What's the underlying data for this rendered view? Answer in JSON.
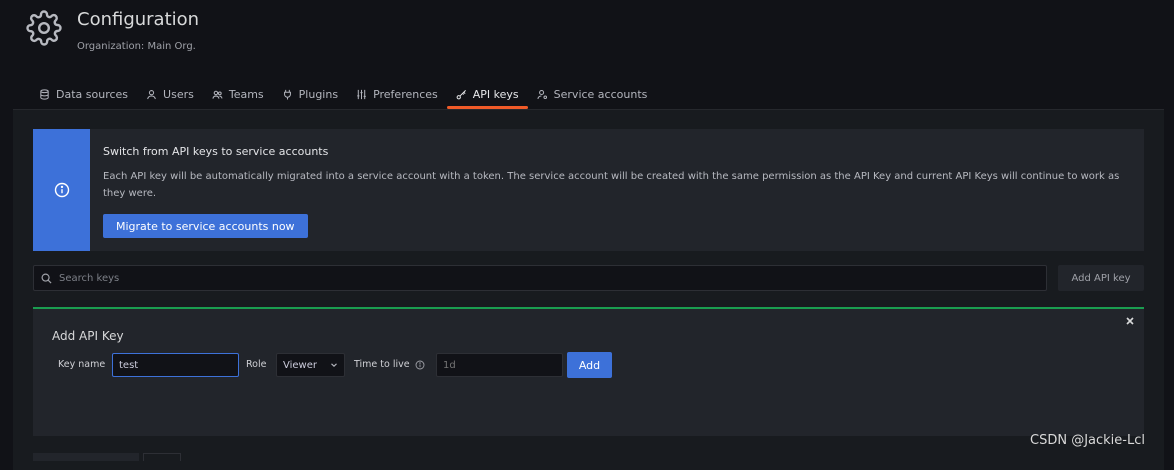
{
  "header": {
    "title": "Configuration",
    "subtitle": "Organization: Main Org.",
    "icon": "gear-icon"
  },
  "tabs": [
    {
      "label": "Data sources",
      "icon": "database-icon",
      "active": false
    },
    {
      "label": "Users",
      "icon": "user-icon",
      "active": false
    },
    {
      "label": "Teams",
      "icon": "users-icon",
      "active": false
    },
    {
      "label": "Plugins",
      "icon": "plug-icon",
      "active": false
    },
    {
      "label": "Preferences",
      "icon": "sliders-icon",
      "active": false
    },
    {
      "label": "API keys",
      "icon": "key-icon",
      "active": true
    },
    {
      "label": "Service accounts",
      "icon": "user-cog-icon",
      "active": false
    }
  ],
  "alert": {
    "title": "Switch from API keys to service accounts",
    "text": "Each API key will be automatically migrated into a service account with a token. The service account will be created with the same permission as the API Key and current API Keys will continue to work as they were.",
    "button_label": "Migrate to service accounts now"
  },
  "search": {
    "placeholder": "Search keys"
  },
  "add_key_button": "Add API key",
  "add_form": {
    "title": "Add API Key",
    "key_name_label": "Key name",
    "key_name_value": "test",
    "role_label": "Role",
    "role_value": "Viewer",
    "ttl_label": "Time to live",
    "ttl_placeholder": "1d",
    "add_label": "Add"
  },
  "watermark": "CSDN @Jackie-Lcl",
  "colors": {
    "accent_blue": "#3d71d9",
    "active_tab_orange": "#f05a28",
    "form_border_green": "#1a9d50"
  }
}
